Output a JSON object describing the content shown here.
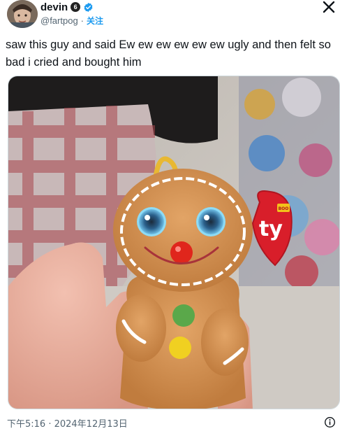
{
  "author": {
    "display_name": "devin",
    "badge_glyph": "6",
    "handle": "@fartpog",
    "separator": "·",
    "follow_label": "关注"
  },
  "icons": {
    "avatar": "avatar-photo",
    "badge": "profile-badge-icon",
    "verified": "verified-check-icon",
    "close": "close-x-icon",
    "info": "info-icon"
  },
  "tweet": {
    "text": "saw this guy and said Ew ew ew ew ew ew ugly and then felt so bad i cried and bought him"
  },
  "media": {
    "description_tag_text": "ty",
    "tag_small_text": "BOO"
  },
  "footer": {
    "timestamp": "下午5:16 · 2024年12月13日"
  },
  "colors": {
    "accent": "#1d9bf0",
    "text": "#0f1419",
    "muted": "#536471"
  }
}
